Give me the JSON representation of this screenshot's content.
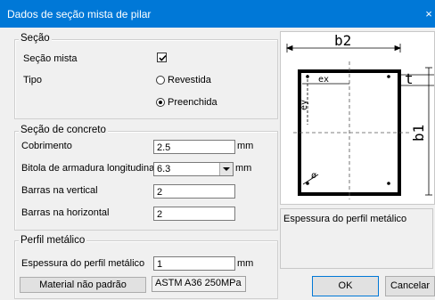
{
  "window": {
    "title": "Dados de seção mista de pilar",
    "close_glyph": "×"
  },
  "section": {
    "legend": "Seção",
    "mixed_label": "Seção mista",
    "mixed_checked": true,
    "type_label": "Tipo",
    "options": [
      {
        "label": "Revestida",
        "selected": false
      },
      {
        "label": "Preenchida",
        "selected": true
      }
    ]
  },
  "concrete": {
    "legend": "Seção de concreto",
    "cover_label": "Cobrimento",
    "cover_value": "2.5",
    "cover_unit": "mm",
    "bar_label": "Bitola de armadura longitudinal",
    "bar_value": "6.3",
    "bar_unit": "mm",
    "vertical_label": "Barras na vertical",
    "vertical_value": "2",
    "horizontal_label": "Barras na horizontal",
    "horizontal_value": "2"
  },
  "profile": {
    "legend": "Perfil metálico",
    "thickness_label": "Espessura do perfil metálico",
    "thickness_value": "1",
    "thickness_unit": "mm",
    "material_button": "Material não padrão",
    "material_value": "ASTM A36 250MPa"
  },
  "preview": {
    "b2": "b2",
    "b1": "b1",
    "t": "t",
    "ex": "ex",
    "ey": "ey",
    "phi": "ø"
  },
  "hint": "Espessura do perfil metálico",
  "buttons": {
    "ok": "OK",
    "cancel": "Cancelar"
  },
  "colors": {
    "titlebar": "#0078d7",
    "default_button_border": "#0078d7"
  }
}
